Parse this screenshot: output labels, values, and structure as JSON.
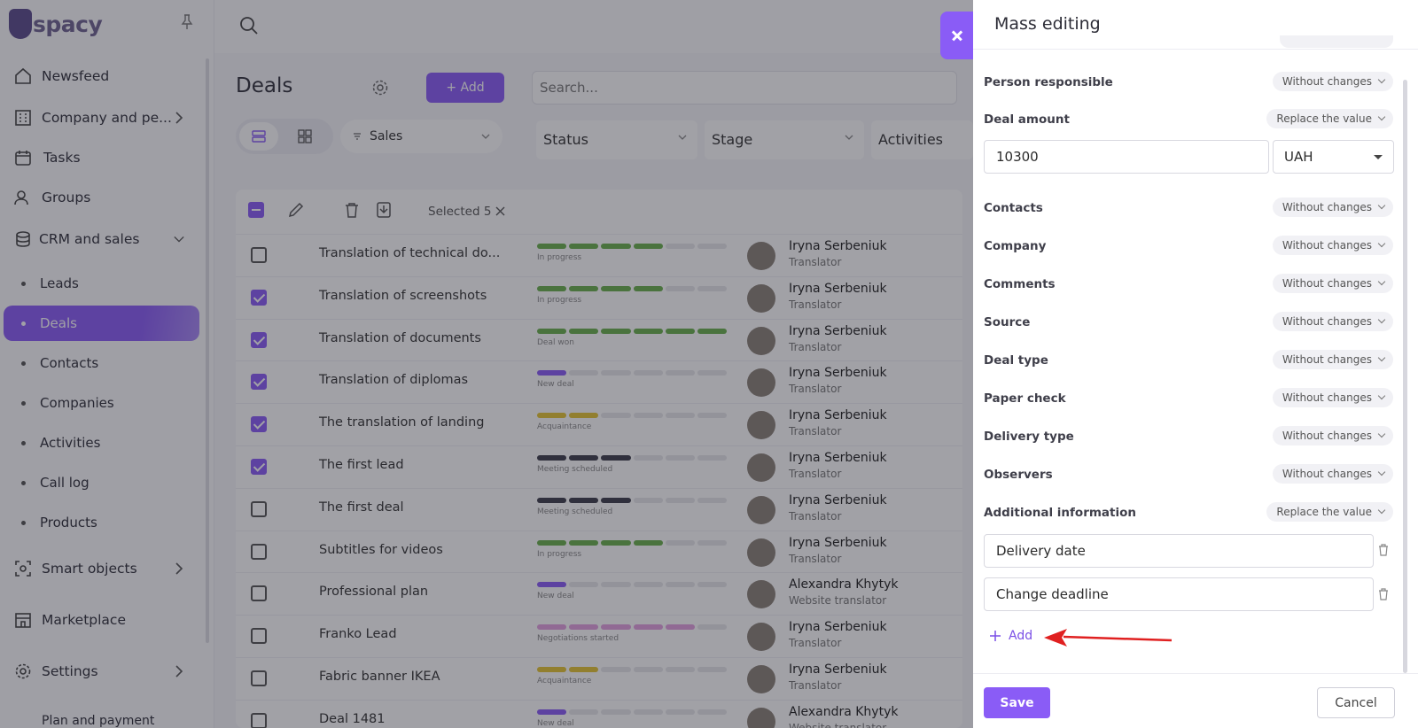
{
  "logo": {
    "text": "spacy"
  },
  "sidebar": {
    "items": [
      {
        "label": "Newsfeed"
      },
      {
        "label": "Company and pe..."
      },
      {
        "label": "Tasks"
      },
      {
        "label": "Groups"
      },
      {
        "label": "CRM and sales"
      },
      {
        "label": "Smart objects"
      },
      {
        "label": "Marketplace"
      },
      {
        "label": "Settings"
      },
      {
        "label": "Plan and payment"
      }
    ],
    "crm_sub": [
      {
        "label": "Leads"
      },
      {
        "label": "Deals",
        "active": true
      },
      {
        "label": "Contacts"
      },
      {
        "label": "Companies"
      },
      {
        "label": "Activities"
      },
      {
        "label": "Call log"
      },
      {
        "label": "Products"
      }
    ]
  },
  "main": {
    "title": "Deals",
    "add_label": "+ Add",
    "search_placeholder": "Search...",
    "pipeline": "Sales",
    "filters": [
      "Status",
      "Stage",
      "Activities"
    ],
    "selected_label": "Selected 5",
    "rows": [
      {
        "name": "Translation of technical do...",
        "checked": false,
        "stage": "In progress",
        "color": "#6ab04c",
        "filled": 4,
        "person": "Iryna Serbeniuk",
        "role": "Translator"
      },
      {
        "name": "Translation of screenshots",
        "checked": true,
        "stage": "In progress",
        "color": "#6ab04c",
        "filled": 4,
        "person": "Iryna Serbeniuk",
        "role": "Translator"
      },
      {
        "name": "Translation of documents",
        "checked": true,
        "stage": "Deal won",
        "color": "#6ab04c",
        "filled": 6,
        "person": "Iryna Serbeniuk",
        "role": "Translator"
      },
      {
        "name": "Translation of diplomas",
        "checked": true,
        "stage": "New deal",
        "color": "#8a5cf6",
        "filled": 1,
        "person": "Iryna Serbeniuk",
        "role": "Translator"
      },
      {
        "name": "The translation of landing",
        "checked": true,
        "stage": "Acquaintance",
        "color": "#e5c532",
        "filled": 2,
        "person": "Iryna Serbeniuk",
        "role": "Translator"
      },
      {
        "name": "The first lead",
        "checked": true,
        "stage": "Meeting scheduled",
        "color": "#3d3d4a",
        "filled": 3,
        "person": "Iryna Serbeniuk",
        "role": "Translator"
      },
      {
        "name": "The first deal",
        "checked": false,
        "stage": "Meeting scheduled",
        "color": "#3d3d4a",
        "filled": 3,
        "person": "Iryna Serbeniuk",
        "role": "Translator"
      },
      {
        "name": "Subtitles for videos",
        "checked": false,
        "stage": "In progress",
        "color": "#6ab04c",
        "filled": 4,
        "person": "Iryna Serbeniuk",
        "role": "Translator"
      },
      {
        "name": "Professional plan",
        "checked": false,
        "stage": "New deal",
        "color": "#8a5cf6",
        "filled": 1,
        "person": "Alexandra Khytyk",
        "role": "Website translator"
      },
      {
        "name": "Franko Lead",
        "checked": false,
        "stage": "Negotiations started",
        "color": "#e3a0e0",
        "filled": 5,
        "person": "Iryna Serbeniuk",
        "role": "Translator"
      },
      {
        "name": "Fabric banner IKEA",
        "checked": false,
        "stage": "Acquaintance",
        "color": "#e5c532",
        "filled": 2,
        "person": "Iryna Serbeniuk",
        "role": "Translator"
      },
      {
        "name": "Deal 1481",
        "checked": false,
        "stage": "New deal",
        "color": "#8a5cf6",
        "filled": 1,
        "person": "Alexandra Khytyk",
        "role": "Website translator"
      }
    ]
  },
  "panel": {
    "title": "Mass editing",
    "fields": [
      {
        "label": "Person responsible",
        "mode": "Without changes"
      },
      {
        "label": "Deal amount",
        "mode": "Replace the value"
      },
      {
        "label": "Contacts",
        "mode": "Without changes"
      },
      {
        "label": "Company",
        "mode": "Without changes"
      },
      {
        "label": "Comments",
        "mode": "Without changes"
      },
      {
        "label": "Source",
        "mode": "Without changes"
      },
      {
        "label": "Deal type",
        "mode": "Without changes"
      },
      {
        "label": "Paper check",
        "mode": "Without changes"
      },
      {
        "label": "Delivery type",
        "mode": "Without changes"
      },
      {
        "label": "Observers",
        "mode": "Without changes"
      },
      {
        "label": "Additional information",
        "mode": "Replace the value"
      }
    ],
    "deal_amount": "10300",
    "currency": "UAH",
    "additional_values": [
      "Delivery date",
      "Change deadline"
    ],
    "add_label": "Add",
    "save_label": "Save",
    "cancel_label": "Cancel"
  },
  "colors": {
    "accent": "#8a5cf6",
    "arrow": "#e02020"
  }
}
